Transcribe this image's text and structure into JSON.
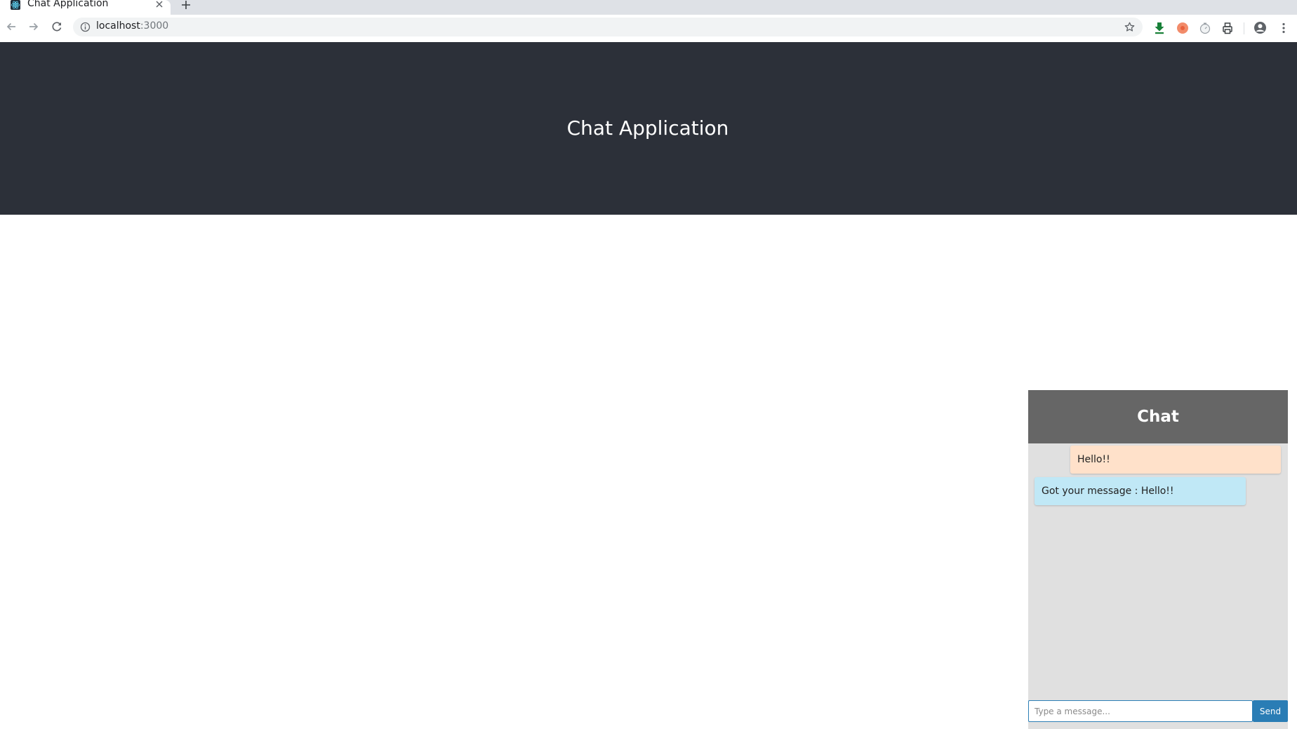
{
  "browser": {
    "tab": {
      "title": "Chat Application",
      "favicon": "react-icon"
    },
    "address": {
      "host": "localhost",
      "port": ":3000"
    },
    "icons": {
      "back": "arrow-left-icon",
      "forward": "arrow-right-icon",
      "reload": "reload-icon",
      "site_info": "info-icon",
      "bookmark": "star-icon",
      "extensions": [
        "green-download-icon",
        "red-record-icon",
        "gray-timer-icon",
        "printer-icon"
      ],
      "profile": "account-circle-icon",
      "menu": "kebab-menu-icon"
    }
  },
  "page": {
    "header": {
      "title": "Chat Application"
    },
    "chat": {
      "title": "Chat",
      "messages": [
        {
          "direction": "sent",
          "text": "Hello!!"
        },
        {
          "direction": "received",
          "text": "Got your message : Hello!!"
        }
      ],
      "input": {
        "value": "",
        "placeholder": "Type a message..."
      },
      "send_label": "Send"
    }
  },
  "colors": {
    "header_bg": "#2c3039",
    "chat_header_bg": "#666666",
    "chat_body_bg": "#e0e0e0",
    "sent_bubble": "#ffe1ca",
    "received_bubble": "#c0e8f6",
    "send_button": "#2a7db5"
  }
}
